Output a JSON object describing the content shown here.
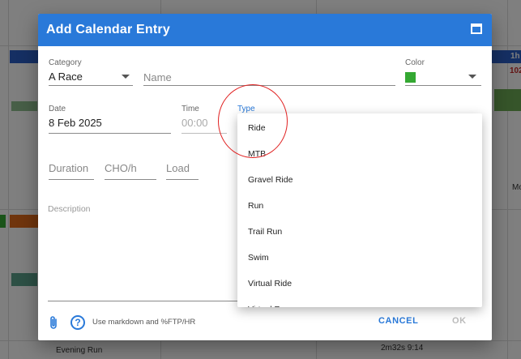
{
  "dialog": {
    "title": "Add Calendar Entry"
  },
  "form": {
    "category": {
      "label": "Category",
      "value": "A Race"
    },
    "name": {
      "placeholder": "Name"
    },
    "color": {
      "label": "Color",
      "value": "#34a832"
    },
    "date": {
      "label": "Date",
      "value": "8 Feb 2025"
    },
    "time": {
      "label": "Time",
      "placeholder": "00:00"
    },
    "type": {
      "label": "Type"
    },
    "duration": {
      "placeholder": "Duration"
    },
    "cho": {
      "placeholder": "CHO/h"
    },
    "load": {
      "placeholder": "Load"
    },
    "description": {
      "placeholder": "Description"
    }
  },
  "type_menu": {
    "items": [
      "Ride",
      "MTB",
      "Gravel Ride",
      "Run",
      "Trail Run",
      "Swim",
      "Virtual Ride",
      "Virtual Run"
    ]
  },
  "footer": {
    "hint": "Use markdown and %FTP/HR",
    "cancel_label": "CANCEL",
    "ok_label": "OK"
  },
  "background": {
    "right_badge": "1h",
    "right_number": "102",
    "right_label": "Mo",
    "bottom_left": "Evening Run",
    "bottom_right": "2m32s 9:14",
    "colors": {
      "accent": "#2979d9",
      "highlight_circle": "#e02020"
    }
  }
}
